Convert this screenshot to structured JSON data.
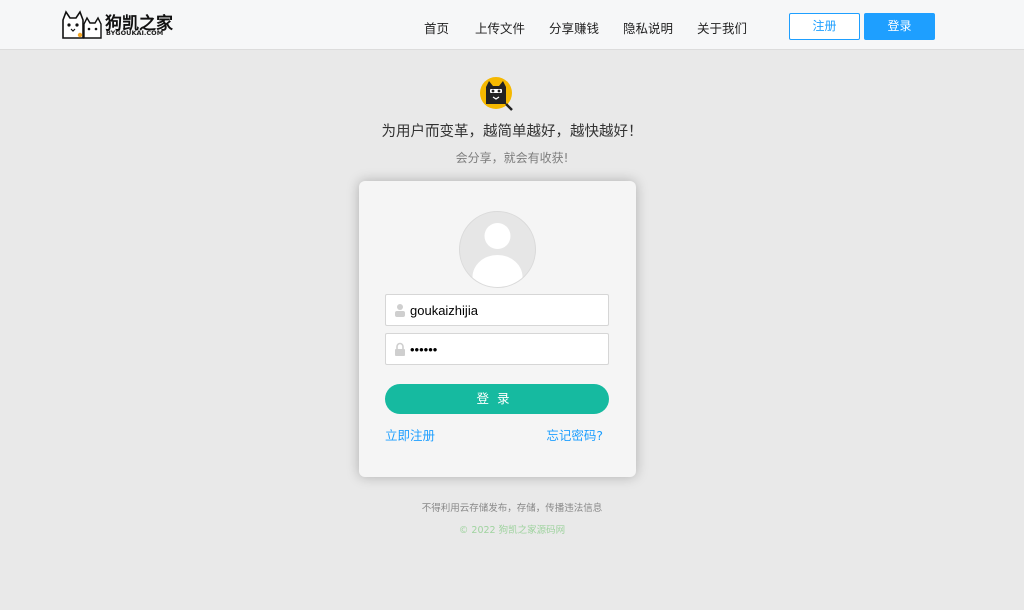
{
  "header": {
    "logo_text": "狗凯之家",
    "logo_sub": "BYGOUKAI.COM",
    "nav": [
      "首页",
      "上传文件",
      "分享赚钱",
      "隐私说明",
      "关于我们"
    ],
    "register_label": "注册",
    "login_label": "登录"
  },
  "hero": {
    "slogan": "为用户而变革，越简单越好，越快越好！",
    "subslogan": "会分享，就会有收获!"
  },
  "form": {
    "username_value": "goukaizhijia",
    "password_value": "••••••",
    "submit_label": "登录",
    "register_link": "立即注册",
    "forgot_link": "忘记密码?"
  },
  "footer": {
    "notice": "不得利用云存储发布，存储，传播违法信息",
    "copyright": "© 2022 狗凯之家源码网"
  },
  "colors": {
    "accent_blue": "#1e9fff",
    "submit_green": "#16baa0",
    "background": "#e9e9e9"
  },
  "icons": {
    "logo": "cat-logo-icon",
    "brand": "cat-badge-icon",
    "avatar": "user-avatar-icon",
    "username": "user-icon",
    "password": "lock-icon"
  }
}
